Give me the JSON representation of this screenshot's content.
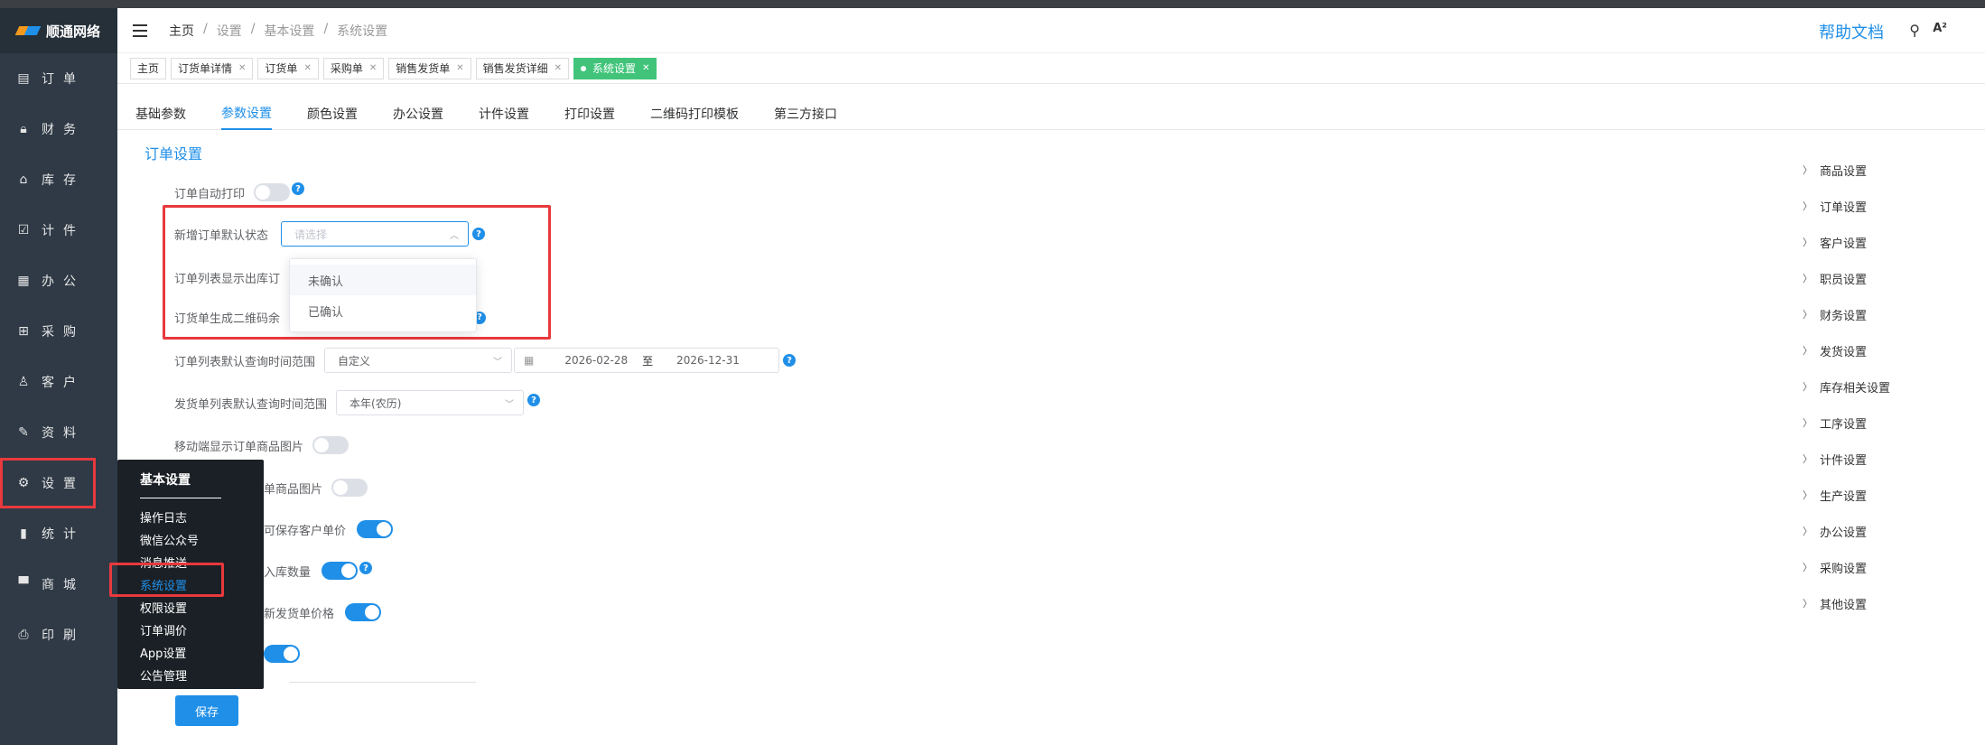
{
  "app": {
    "brand": "顺通网络"
  },
  "sidebar": {
    "items": [
      {
        "label": "订单",
        "icon": "receipt-icon"
      },
      {
        "label": "财务",
        "icon": "lock-icon"
      },
      {
        "label": "库存",
        "icon": "home-icon"
      },
      {
        "label": "计件",
        "icon": "clipboard-icon"
      },
      {
        "label": "办公",
        "icon": "calendar-icon"
      },
      {
        "label": "采购",
        "icon": "bag-icon"
      },
      {
        "label": "客户",
        "icon": "user-icon"
      },
      {
        "label": "资料",
        "icon": "edit-icon"
      },
      {
        "label": "设置",
        "icon": "gear-icon"
      },
      {
        "label": "统计",
        "icon": "bar-chart-icon"
      },
      {
        "label": "商城",
        "icon": "store-icon"
      },
      {
        "label": "印刷",
        "icon": "printer-icon"
      }
    ]
  },
  "header": {
    "breadcrumb": [
      "主页",
      "设置",
      "基本设置",
      "系统设置"
    ],
    "help": "帮助文档"
  },
  "tabs": [
    {
      "label": "主页",
      "closable": false
    },
    {
      "label": "订货单详情",
      "closable": true
    },
    {
      "label": "订货单",
      "closable": true
    },
    {
      "label": "采购单",
      "closable": true
    },
    {
      "label": "销售发货单",
      "closable": true
    },
    {
      "label": "销售发货详细",
      "closable": true
    },
    {
      "label": "系统设置",
      "closable": true,
      "active": true
    }
  ],
  "subtabs": [
    "基础参数",
    "参数设置",
    "颜色设置",
    "办公设置",
    "计件设置",
    "打印设置",
    "二维码打印模板",
    "第三方接口"
  ],
  "section_title": "订单设置",
  "form": {
    "auto_print": "订单自动打印",
    "default_status": "新增订单默认状态",
    "default_status_placeholder": "请选择",
    "list_show_out": "订单列表显示出库订",
    "qrcode_gen": "订货单生成二维码余",
    "list_query_range": "订单列表默认查询时间范围",
    "list_query_value": "自定义",
    "date_start": "2026-02-28",
    "date_sep": "至",
    "date_end": "2026-12-31",
    "ship_query_range": "发货单列表默认查询时间范围",
    "ship_query_value": "本年(农历)",
    "mobile_show_img": "移动端显示订单商品图片",
    "row6_partial": "单商品图片",
    "row7_partial": "可保存客户单价",
    "row8_partial": "入库数量",
    "row9_partial": "新发货单价格",
    "save": "保存"
  },
  "dropdown": [
    "未确认",
    "已确认"
  ],
  "popmenu": {
    "title": "基本设置",
    "items": [
      "操作日志",
      "微信公众号",
      "消息推送",
      "系统设置",
      "权限设置",
      "订单调价",
      "App设置",
      "公告管理"
    ]
  },
  "rightnav": [
    "商品设置",
    "订单设置",
    "客户设置",
    "职员设置",
    "财务设置",
    "发货设置",
    "库存相关设置",
    "工序设置",
    "计件设置",
    "生产设置",
    "办公设置",
    "采购设置",
    "其他设置"
  ],
  "colors": {
    "primary": "#1f8fe8",
    "active_tab": "#41c47a",
    "highlight": "#e8393d",
    "sidebar": "#2f3a46"
  }
}
